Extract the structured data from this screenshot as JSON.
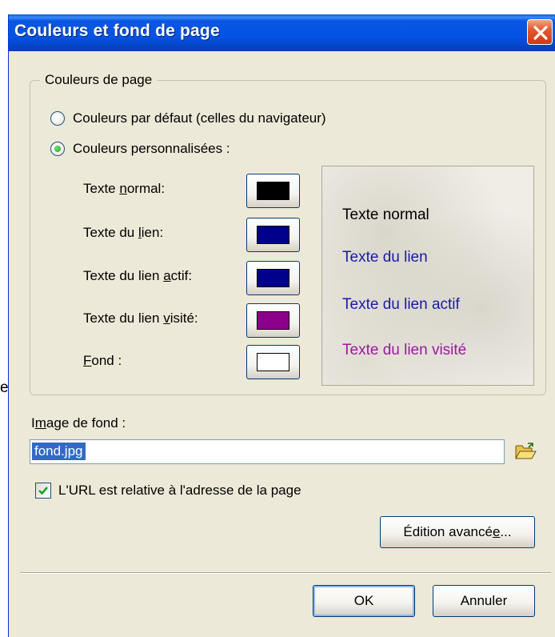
{
  "stray_char": "e",
  "window": {
    "title": "Couleurs et fond de page"
  },
  "page_colors": {
    "group_title": "Couleurs de page",
    "radio_default": {
      "label": "Couleurs par défaut (celles du navigateur)",
      "checked": false
    },
    "radio_custom": {
      "label": "Couleurs personnalisées :",
      "checked": true
    },
    "color_rows": [
      {
        "label_pre": "Texte ",
        "label_key": "n",
        "label_post": "ormal:",
        "color": "#000000"
      },
      {
        "label_pre": "Texte du ",
        "label_key": "l",
        "label_post": "ien:",
        "color": "#00008b"
      },
      {
        "label_pre": "Texte du lien ",
        "label_key": "a",
        "label_post": "ctif:",
        "color": "#00008b"
      },
      {
        "label_pre": "Texte du lien ",
        "label_key": "v",
        "label_post": "isité:",
        "color": "#8b008b"
      },
      {
        "label_pre": "",
        "label_key": "F",
        "label_post": "ond :",
        "color": "#ffffff"
      }
    ],
    "preview": {
      "normal": {
        "text": "Texte normal",
        "color": "#000000"
      },
      "link": {
        "text": "Texte du lien",
        "color": "#1a1aa8"
      },
      "active": {
        "text": "Texte du lien actif",
        "color": "#1a1aa8"
      },
      "visited": {
        "text": "Texte du lien visité",
        "color": "#9b1a9b"
      }
    }
  },
  "background_image": {
    "label_pre": "I",
    "label_key": "m",
    "label_post": "age de fond :",
    "value": "fond.jpg",
    "relative_checkbox_label": "L'URL est relative à l'adresse de la page",
    "relative_checked": true
  },
  "buttons": {
    "advanced_pre": "Édition avancé",
    "advanced_key": "e",
    "advanced_post": "...",
    "ok": "OK",
    "cancel": "Annuler"
  }
}
